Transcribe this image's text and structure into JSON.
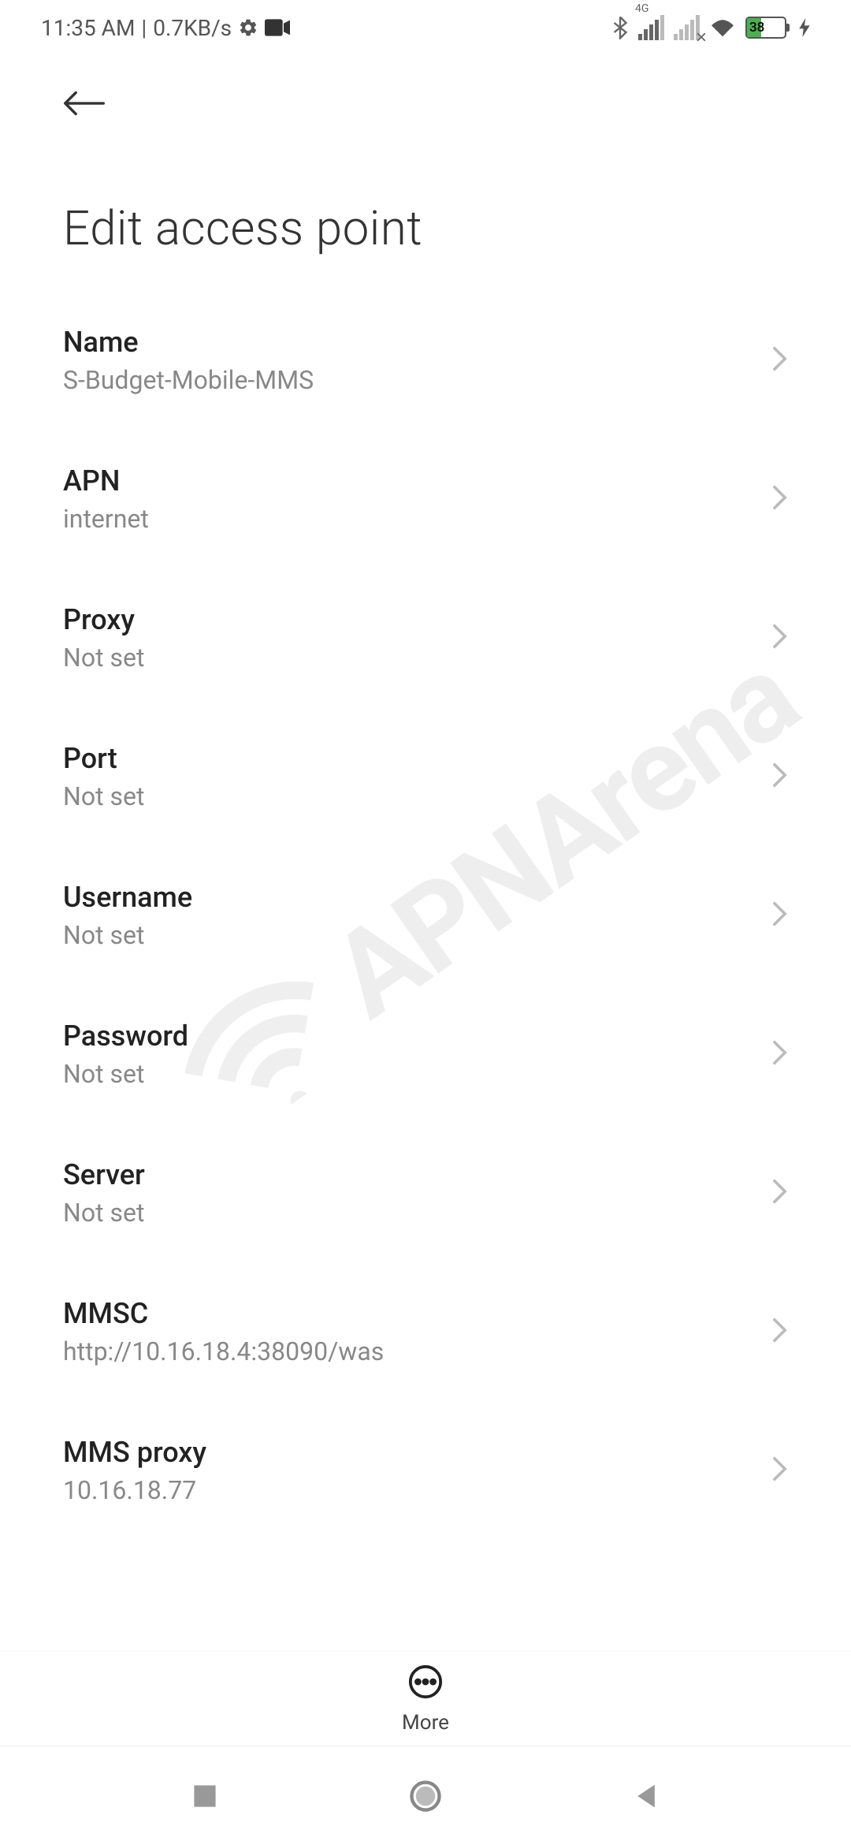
{
  "status": {
    "time": "11:35 AM",
    "data_rate": "0.7KB/s",
    "network_label": "4G",
    "battery_pct": "38"
  },
  "header": {
    "title": "Edit access point"
  },
  "settings": [
    {
      "label": "Name",
      "value": "S-Budget-Mobile-MMS"
    },
    {
      "label": "APN",
      "value": "internet"
    },
    {
      "label": "Proxy",
      "value": "Not set"
    },
    {
      "label": "Port",
      "value": "Not set"
    },
    {
      "label": "Username",
      "value": "Not set"
    },
    {
      "label": "Password",
      "value": "Not set"
    },
    {
      "label": "Server",
      "value": "Not set"
    },
    {
      "label": "MMSC",
      "value": "http://10.16.18.4:38090/was"
    },
    {
      "label": "MMS proxy",
      "value": "10.16.18.77"
    }
  ],
  "more": {
    "label": "More"
  },
  "watermark": {
    "text": "APNArena"
  }
}
